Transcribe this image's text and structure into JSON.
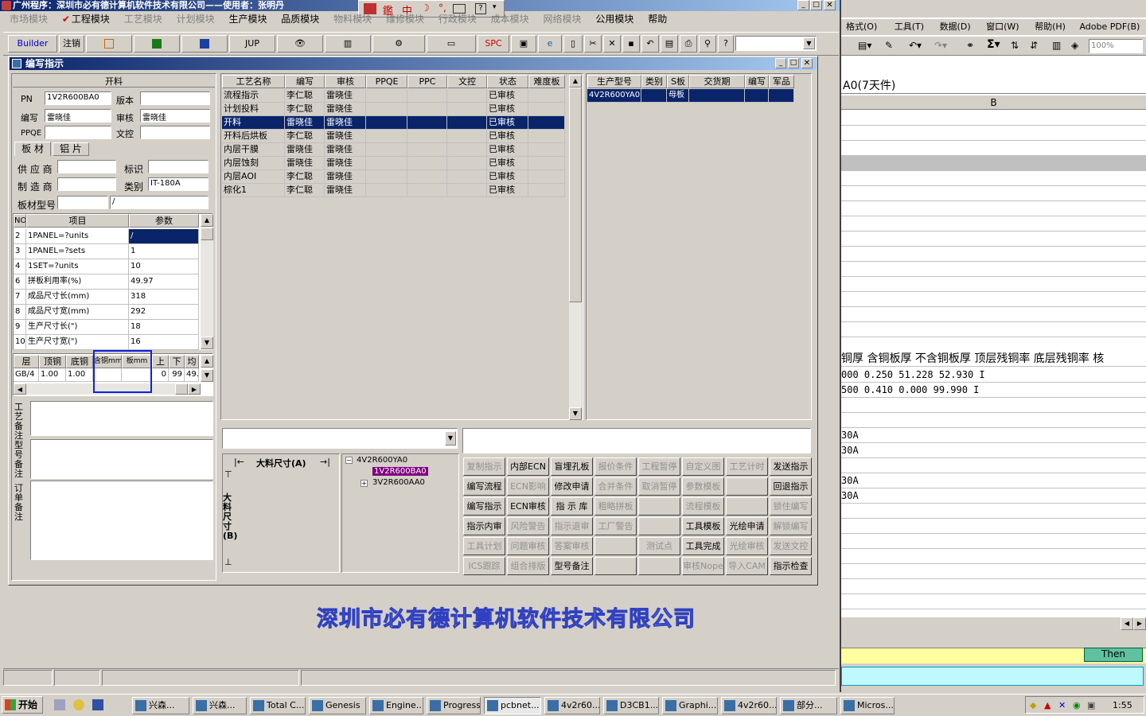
{
  "app": {
    "title": "广州程序：深圳市必有德计算机软件技术有限公司——使用者：张明丹",
    "menu": [
      "市场模块",
      "工程模块",
      "工艺模块",
      "计划模块",
      "生产模块",
      "品质模块",
      "物料模块",
      "维修模块",
      "行政模块",
      "成本模块",
      "网络模块",
      "公用模块",
      "帮助"
    ]
  },
  "toolbar": {
    "builder": "Builder",
    "logout": "注销",
    "jup": "JUP",
    "spc": "SPC"
  },
  "ime": {
    "mode": "中"
  },
  "child_window": {
    "title": "编写指示"
  },
  "left": {
    "section_title": "开料",
    "pn_label": "PN",
    "pn_value": "1V2R600BA0",
    "version_label": "版本",
    "version_value": "",
    "writer_label": "编写",
    "writer_value": "雷晓佳",
    "auditor_label": "审核",
    "auditor_value": "雷晓佳",
    "ppqe_label": "PPQE",
    "ppqe_value": "",
    "doc_label": "文控",
    "doc_value": "",
    "tab_board": "板 材",
    "tab_copper": "铝 片",
    "supplier_label": "供 应 商",
    "supplier_value": "",
    "mark_label": "标识",
    "mark_value": "",
    "maker_label": "制 造 商",
    "maker_value": "",
    "category_label": "类别",
    "category_value": "IT-180A",
    "model_label": "板材型号",
    "model_value": "",
    "model_value2": "/",
    "param_headers": [
      "NO",
      "项目",
      "参数"
    ],
    "params": [
      {
        "no": "2",
        "item": "1PANEL=?units",
        "val": "/"
      },
      {
        "no": "3",
        "item": "1PANEL=?sets",
        "val": "1"
      },
      {
        "no": "4",
        "item": "1SET=?units",
        "val": "10"
      },
      {
        "no": "6",
        "item": "拼板利用率(%)",
        "val": "49.97"
      },
      {
        "no": "7",
        "item": "成品尺寸长(mm)",
        "val": "318"
      },
      {
        "no": "8",
        "item": "成品尺寸宽(mm)",
        "val": "292"
      },
      {
        "no": "9",
        "item": "生产尺寸长(\")",
        "val": "18"
      },
      {
        "no": "10",
        "item": "生产尺寸宽(\")",
        "val": "16"
      }
    ],
    "layer_headers": [
      "层",
      "顶铜",
      "底铜",
      "含铜mm",
      "板mm",
      "上",
      "下",
      "均"
    ],
    "layer_row": [
      "GB/4",
      "1.00",
      "1.00",
      "",
      "",
      "0",
      "99",
      "49."
    ],
    "note_process": "工艺备注",
    "note_model": "型号备注",
    "note_order": "订单备注"
  },
  "process_grid": {
    "headers": [
      "工艺名称",
      "编写",
      "审核",
      "PPQE",
      "PPC",
      "文控",
      "状态",
      "难度板"
    ],
    "rows": [
      [
        "流程指示",
        "李仁聪",
        "雷晓佳",
        "",
        "",
        "",
        "已审核",
        ""
      ],
      [
        "计划投料",
        "李仁聪",
        "雷晓佳",
        "",
        "",
        "",
        "已审核",
        ""
      ],
      [
        "开料",
        "雷晓佳",
        "雷晓佳",
        "",
        "",
        "",
        "已审核",
        ""
      ],
      [
        "开料后烘板",
        "李仁聪",
        "雷晓佳",
        "",
        "",
        "",
        "已审核",
        ""
      ],
      [
        "内层干膜",
        "雷晓佳",
        "雷晓佳",
        "",
        "",
        "",
        "已审核",
        ""
      ],
      [
        "内层蚀刻",
        "雷晓佳",
        "雷晓佳",
        "",
        "",
        "",
        "已审核",
        ""
      ],
      [
        "内层AOI",
        "李仁聪",
        "雷晓佳",
        "",
        "",
        "",
        "已审核",
        ""
      ],
      [
        "棕化1",
        "李仁聪",
        "雷晓佳",
        "",
        "",
        "",
        "已审核",
        ""
      ]
    ],
    "selected_index": 2
  },
  "model_grid": {
    "headers": [
      "生产型号",
      "类别",
      "S板",
      "交货期",
      "编写",
      "军品"
    ],
    "rows": [
      [
        "4V2R600YA0",
        "",
        "母板",
        "",
        "",
        ""
      ]
    ]
  },
  "diagram": {
    "a_label": "大料尺寸(A)",
    "b_label": "大料尺寸(B)"
  },
  "tree": {
    "root": "4V2R600YA0",
    "child1": "1V2R600BA0",
    "child2": "3V2R600AA0"
  },
  "actions": [
    [
      "复制指示",
      "内部ECN",
      "盲埋孔板",
      "报价条件",
      "工程暂停",
      "自定义图",
      "工艺计时",
      "发送指示"
    ],
    [
      "编写流程",
      "ECN影响",
      "修改申请",
      "合并条件",
      "取消暂停",
      "参数模板",
      "",
      "回退指示"
    ],
    [
      "编写指示",
      "ECN审核",
      "指 示 库",
      "粗略拼板",
      "",
      "流程模板",
      "",
      "锁住编写"
    ],
    [
      "指示内审",
      "风险警告",
      "指示退审",
      "工厂警告",
      "",
      "工具模板",
      "光绘申请",
      "解锁编写"
    ],
    [
      "工具计划",
      "问题审核",
      "答案审核",
      "",
      "测试点",
      "工具完成",
      "光绘审核",
      "发送文控"
    ],
    [
      "ICS跟踪",
      "组合排版",
      "型号备注",
      "",
      "",
      "审核Nope",
      "导入CAM",
      "指示检查"
    ]
  ],
  "actions_disabled": [
    [
      true,
      false,
      false,
      true,
      true,
      true,
      true,
      false
    ],
    [
      false,
      true,
      false,
      true,
      true,
      true,
      false,
      false
    ],
    [
      false,
      false,
      false,
      true,
      false,
      true,
      false,
      true
    ],
    [
      false,
      true,
      true,
      true,
      false,
      false,
      false,
      true
    ],
    [
      true,
      true,
      true,
      false,
      true,
      false,
      true,
      true
    ],
    [
      true,
      true,
      false,
      false,
      false,
      true,
      true,
      false
    ]
  ],
  "watermark": "深圳市必有德计算机软件技术有限公司",
  "excel": {
    "menu": [
      "格式(O)",
      "工具(T)",
      "数据(D)",
      "窗口(W)",
      "帮助(H)",
      "Adobe PDF(B)"
    ],
    "zoom": "100%",
    "formula_text": "A0(7天件)",
    "col_b": "B",
    "header_row": "铜厚  含铜板厚  不含铜板厚  顶层残铜率  底层残铜率  核",
    "row1": "000          0.250     51.228    52.930    I",
    "row2": "500          0.410      0.000    99.990    I",
    "r3": "30A",
    "r4": "30A",
    "r5": "30A",
    "r6": "30A",
    "tab_label": "Then"
  },
  "taskbar": {
    "start": "开始",
    "items": [
      "兴森...",
      "兴森...",
      "Total C...",
      "Genesis",
      "Engine...",
      "Progress",
      "pcbnet...",
      "4v2r60...",
      "D3CB1...",
      "Graphi...",
      "4v2r60...",
      "部分...",
      "Micros..."
    ],
    "clock": "1:55"
  }
}
